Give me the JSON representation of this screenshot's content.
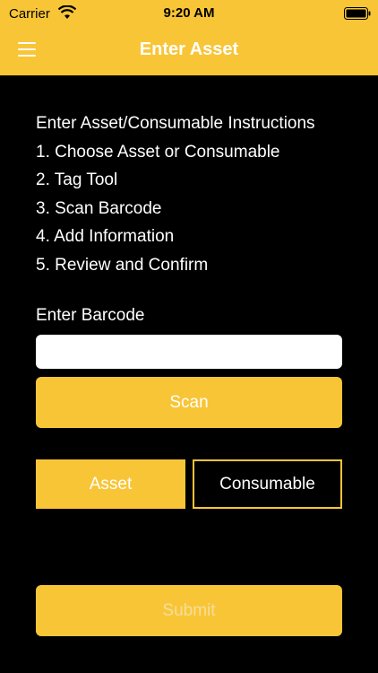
{
  "status_bar": {
    "carrier": "Carrier",
    "time": "9:20 AM",
    "wifi_icon": "wifi-icon",
    "battery_icon": "battery-icon"
  },
  "header": {
    "title": "Enter Asset",
    "menu_icon": "hamburger-menu-icon"
  },
  "instructions": {
    "heading": "Enter Asset/Consumable Instructions",
    "steps": [
      "1. Choose Asset or Consumable",
      "2. Tag Tool",
      "3. Scan Barcode",
      "4. Add Information",
      "5. Review and Confirm"
    ]
  },
  "barcode": {
    "label": "Enter Barcode",
    "value": "",
    "scan_label": "Scan"
  },
  "type_toggle": {
    "asset_label": "Asset",
    "consumable_label": "Consumable",
    "selected": "Asset"
  },
  "submit": {
    "label": "Submit",
    "enabled": false
  },
  "colors": {
    "accent": "#F8C537",
    "background": "#000000",
    "text": "#FFFFFF",
    "disabled_text": "#F6DE9A"
  }
}
